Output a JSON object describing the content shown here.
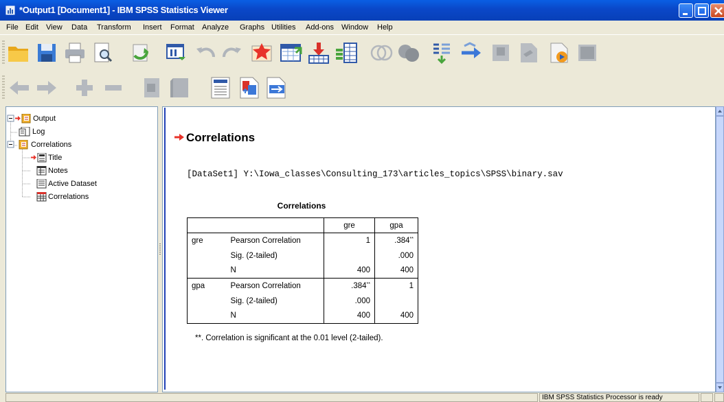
{
  "window": {
    "title": "*Output1 [Document1] - IBM SPSS Statistics Viewer"
  },
  "menu": [
    "File",
    "Edit",
    "View",
    "Data",
    "Transform",
    "Insert",
    "Format",
    "Analyze",
    "Graphs",
    "Utilities",
    "Add-ons",
    "Window",
    "Help"
  ],
  "toolbar1_icons": [
    "open-folder-icon",
    "save-icon",
    "print-icon",
    "print-preview-icon",
    "export-icon",
    "dialog-recall-icon",
    "undo-icon",
    "redo-icon",
    "goto-data-icon",
    "goto-case-icon",
    "goto-variable-icon",
    "variables-icon",
    "use-sets-icon",
    "show-all-variables-icon",
    "select-last-output-icon",
    "designate-window-icon",
    "create-title-icon",
    "create-text-icon",
    "insert-output-icon",
    "script-icon"
  ],
  "toolbar2_icons": [
    "promote-icon",
    "demote-icon",
    "expand-icon",
    "collapse-icon",
    "show-icon",
    "hide-icon",
    "insert-heading-icon",
    "insert-title-icon",
    "insert-text-icon"
  ],
  "tree": {
    "output": "Output",
    "log": "Log",
    "correlations_folder": "Correlations",
    "title": "Title",
    "notes": "Notes",
    "active_dataset": "Active Dataset",
    "correlations_table": "Correlations"
  },
  "output": {
    "heading": "Correlations",
    "dataset_line": "[DataSet1] Y:\\Iowa_classes\\Consulting_173\\articles_topics\\SPSS\\binary.sav",
    "table_title": "Correlations",
    "columns": [
      "gre",
      "gpa"
    ],
    "rows": [
      {
        "var": "gre",
        "stat": "Pearson Correlation",
        "gre": "1",
        "gpa": ".384",
        "gpa_sup": "**"
      },
      {
        "var": "",
        "stat": "Sig. (2-tailed)",
        "gre": "",
        "gpa": ".000"
      },
      {
        "var": "",
        "stat": "N",
        "gre": "400",
        "gpa": "400"
      },
      {
        "var": "gpa",
        "stat": "Pearson Correlation",
        "gre": ".384",
        "gre_sup": "**",
        "gpa": "1"
      },
      {
        "var": "",
        "stat": "Sig. (2-tailed)",
        "gre": ".000",
        "gpa": ""
      },
      {
        "var": "",
        "stat": "N",
        "gre": "400",
        "gpa": "400"
      }
    ],
    "footnote": "**. Correlation is significant at the 0.01 level (2-tailed)."
  },
  "status": {
    "text": "IBM SPSS Statistics Processor is ready"
  }
}
